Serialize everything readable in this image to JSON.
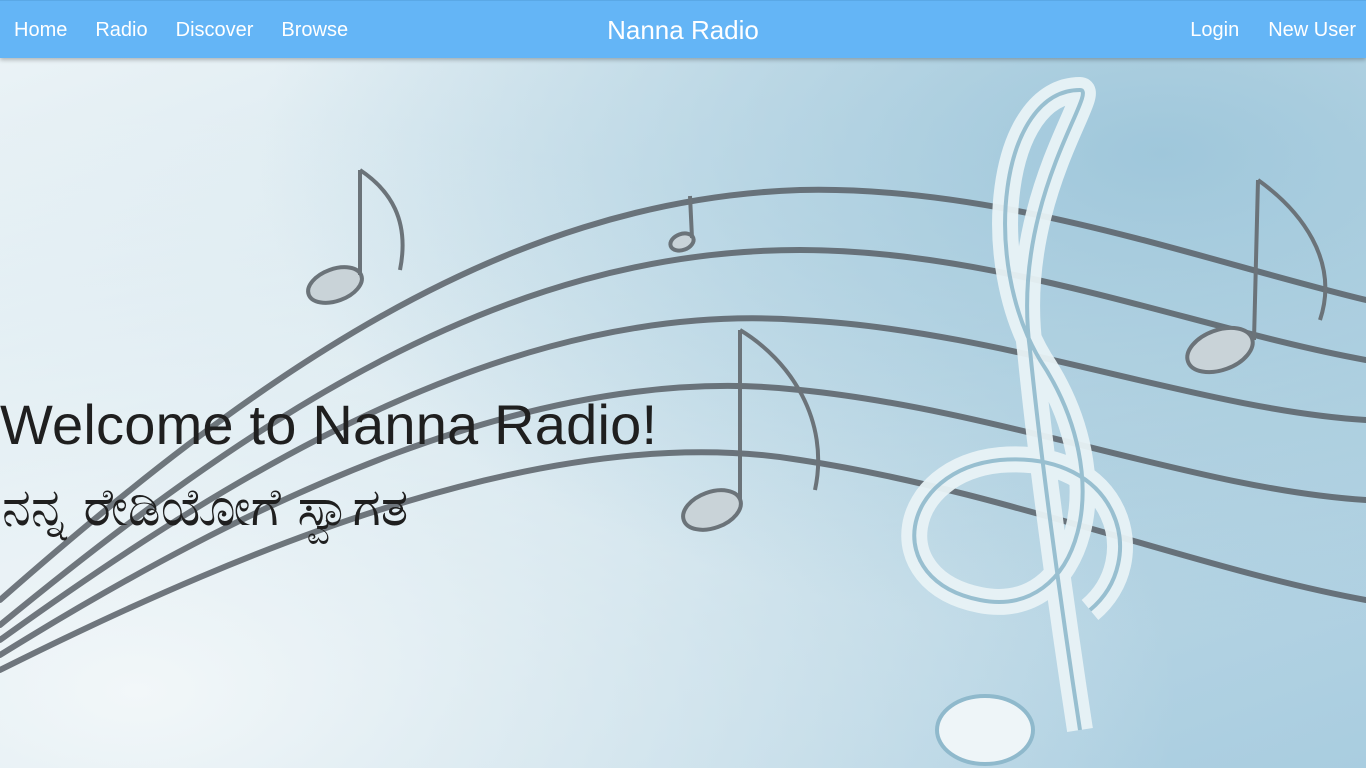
{
  "navbar": {
    "left_links": [
      {
        "label": "Home"
      },
      {
        "label": "Radio"
      },
      {
        "label": "Discover"
      },
      {
        "label": "Browse"
      }
    ],
    "brand": "Nanna Radio",
    "right_links": [
      {
        "label": "Login"
      },
      {
        "label": "New User"
      }
    ],
    "color": "#64b5f6"
  },
  "hero": {
    "heading": "Welcome to Nanna Radio!",
    "heading_kannada": "ನನ್ನ ರೇಡಿಯೋಗೆ ಸ್ವಾಗತ",
    "background_image": "music-notes-treble-clef-icon"
  }
}
